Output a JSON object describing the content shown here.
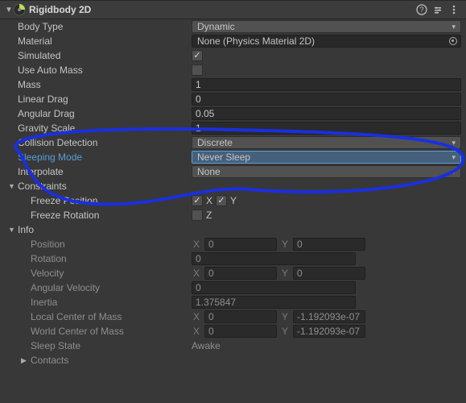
{
  "header": {
    "title": "Rigidbody 2D"
  },
  "props": {
    "bodyType": {
      "label": "Body Type",
      "value": "Dynamic"
    },
    "material": {
      "label": "Material",
      "value": "None (Physics Material 2D)"
    },
    "simulated": {
      "label": "Simulated",
      "checked": true
    },
    "useAutoMass": {
      "label": "Use Auto Mass",
      "checked": false
    },
    "mass": {
      "label": "Mass",
      "value": "1"
    },
    "linearDrag": {
      "label": "Linear Drag",
      "value": "0"
    },
    "angularDrag": {
      "label": "Angular Drag",
      "value": "0.05"
    },
    "gravityScale": {
      "label": "Gravity Scale",
      "value": "1"
    },
    "collisionDetection": {
      "label": "Collision Detection",
      "value": "Discrete"
    },
    "sleepingMode": {
      "label": "Sleeping Mode",
      "value": "Never Sleep"
    },
    "interpolate": {
      "label": "Interpolate",
      "value": "None"
    },
    "constraints": {
      "label": "Constraints",
      "freezePosition": {
        "label": "Freeze Position",
        "x": true,
        "y": true,
        "xl": "X",
        "yl": "Y"
      },
      "freezeRotation": {
        "label": "Freeze Rotation",
        "z": false,
        "zl": "Z"
      }
    },
    "info": {
      "label": "Info",
      "position": {
        "label": "Position",
        "x": "0",
        "y": "0"
      },
      "rotation": {
        "label": "Rotation",
        "value": "0"
      },
      "velocity": {
        "label": "Velocity",
        "x": "0",
        "y": "0"
      },
      "angularVelocity": {
        "label": "Angular Velocity",
        "value": "0"
      },
      "inertia": {
        "label": "Inertia",
        "value": "1.375847"
      },
      "localCOM": {
        "label": "Local Center of Mass",
        "x": "0",
        "y": "-1.192093e-07"
      },
      "worldCOM": {
        "label": "World Center of Mass",
        "x": "0",
        "y": "-1.192093e-07"
      },
      "sleepState": {
        "label": "Sleep State",
        "value": "Awake"
      },
      "contacts": {
        "label": "Contacts"
      }
    }
  },
  "axis": {
    "x": "X",
    "y": "Y",
    "z": "Z"
  }
}
